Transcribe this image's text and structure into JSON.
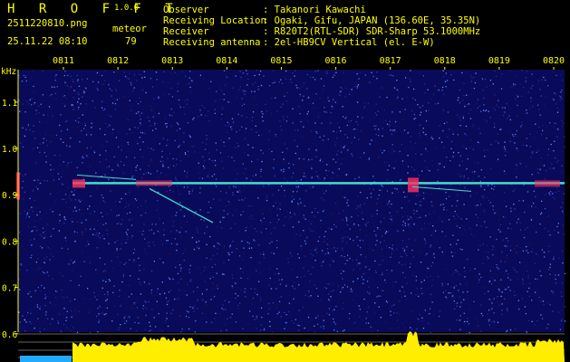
{
  "header": {
    "app_name": "H R O F F T",
    "version": "1.0.0",
    "filename": "2511220810.png",
    "datetime": "25.11.22 08:10",
    "count_label": "meteor",
    "count_value": "79",
    "observer_label": "Observer",
    "observer_value": ": Takanori Kawachi",
    "location_label": "Receiving Location",
    "location_value": ": Ogaki, Gifu, JAPAN (136.60E, 35.35N)",
    "receiver_label": "Receiver",
    "receiver_value": ": R820T2(RTL-SDR) SDR-Sharp 53.1000MHz",
    "antenna_label": "Receiving antenna",
    "antenna_value": ": 2el-HB9CV Vertical (el. E-W)"
  },
  "colors": {
    "text": "#ffff00",
    "background": "#000000",
    "spectrogram_bg": "#0a0a5a",
    "signal_line": "#40e0d0",
    "signal_hot": "#ff3060",
    "gridline": "#c8c8c8"
  },
  "chart_data": {
    "type": "heatmap",
    "title": "",
    "ylabel": "kHz",
    "x_ticks": [
      "0811",
      "0812",
      "0813",
      "0814",
      "0815",
      "0816",
      "0817",
      "0818",
      "0819",
      "0820"
    ],
    "y_ticks": [
      1.1,
      1.0,
      0.9,
      0.8,
      0.7,
      0.6
    ],
    "ylim": [
      0.58,
      1.17
    ],
    "carrier_khz": 0.925,
    "bottom_panel": "signal level bar graph"
  }
}
